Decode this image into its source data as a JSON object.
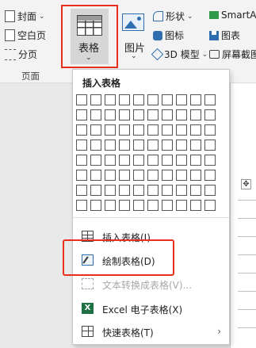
{
  "ribbon": {
    "pages_group": {
      "label": "页面",
      "items": [
        {
          "label": "封面",
          "icon": "cover-page-icon",
          "has_dropdown": true
        },
        {
          "label": "空白页",
          "icon": "blank-page-icon"
        },
        {
          "label": "分页",
          "icon": "page-break-icon"
        }
      ]
    },
    "table_button": {
      "label": "表格",
      "icon": "table-icon",
      "caret": "⌄"
    },
    "picture_button": {
      "label": "图片",
      "icon": "picture-icon",
      "caret": "⌄"
    },
    "illustrations": [
      {
        "label": "形状",
        "icon": "shapes-icon",
        "caret": "⌄"
      },
      {
        "label": "图标",
        "icon": "icons-icon"
      },
      {
        "label": "3D 模型",
        "icon": "3d-model-icon",
        "caret": "⌄"
      }
    ],
    "right_items": [
      {
        "label": "SmartA",
        "icon": "smartart-icon"
      },
      {
        "label": "图表",
        "icon": "chart-icon"
      },
      {
        "label": "屏幕截图",
        "icon": "screenshot-icon"
      }
    ]
  },
  "table_menu": {
    "header": "插入表格",
    "grid": {
      "columns": 10,
      "rows": 8
    },
    "items": [
      {
        "label": "插入表格(I)...",
        "icon": "insert-table-icon",
        "enabled": true
      },
      {
        "label": "绘制表格(D)",
        "icon": "draw-table-icon",
        "enabled": true,
        "highlighted": true
      },
      {
        "label": "文本转换成表格(V)...",
        "icon": "convert-text-icon",
        "enabled": false
      },
      {
        "label": "Excel 电子表格(X)",
        "icon": "excel-icon",
        "enabled": true
      },
      {
        "label": "快速表格(T)",
        "icon": "quick-tables-icon",
        "enabled": true,
        "submenu_arrow": "›"
      }
    ]
  },
  "colors": {
    "highlight": "#e8301c",
    "ribbon_bg": "#f3f3f3",
    "accent": "#2f6fb0",
    "excel": "#1e7145"
  }
}
